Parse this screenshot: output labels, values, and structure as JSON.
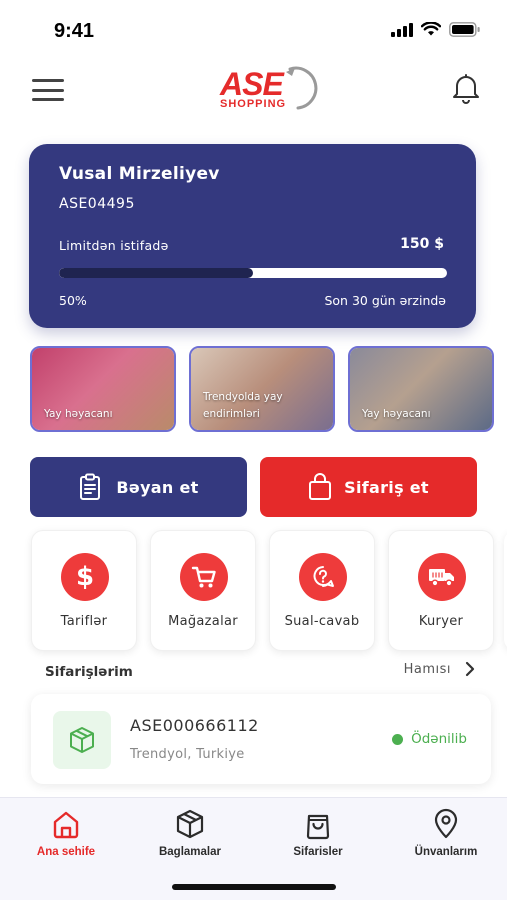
{
  "status_bar": {
    "time": "9:41"
  },
  "header": {
    "logo_main": "ASE",
    "logo_sub": "SHOPPING"
  },
  "account": {
    "name": "Vusal Mirzeliyev",
    "code": "ASE04495",
    "limit_label": "Limitdən istifadə",
    "limit_value": "150 $",
    "progress_percent_label": "50%",
    "progress_fraction": 0.5,
    "period_label": "Son 30 gün ərzində"
  },
  "banners": [
    {
      "text": "Yay həyacanı"
    },
    {
      "text": "Trendyolda yay endirimləri"
    },
    {
      "text": "Yay həyacanı"
    }
  ],
  "actions": {
    "declare_label": "Bəyan et",
    "order_label": "Sifariş et"
  },
  "tiles": [
    {
      "label": "Tariflər",
      "icon": "dollar-icon"
    },
    {
      "label": "Mağazalar",
      "icon": "cart-icon"
    },
    {
      "label": "Sual-cavab",
      "icon": "question-chat-icon"
    },
    {
      "label": "Kuryer",
      "icon": "truck-icon"
    }
  ],
  "orders": {
    "section_title": "Sifarişlərim",
    "see_all_label": "Hamısı",
    "items": [
      {
        "code": "ASE000666112",
        "store": "Trendyol, Turkiye",
        "status": "Ödənilib"
      }
    ]
  },
  "bottom_nav": [
    {
      "label": "Ana sehife",
      "icon": "home-icon",
      "active": true
    },
    {
      "label": "Baglamalar",
      "icon": "package-icon",
      "active": false
    },
    {
      "label": "Sifarisler",
      "icon": "shopping-bag-icon",
      "active": false
    },
    {
      "label": "Ünvanlarım",
      "icon": "location-pin-icon",
      "active": false
    }
  ],
  "colors": {
    "primary": "#34397f",
    "accent": "#e52a2a",
    "success": "#4caf50"
  }
}
